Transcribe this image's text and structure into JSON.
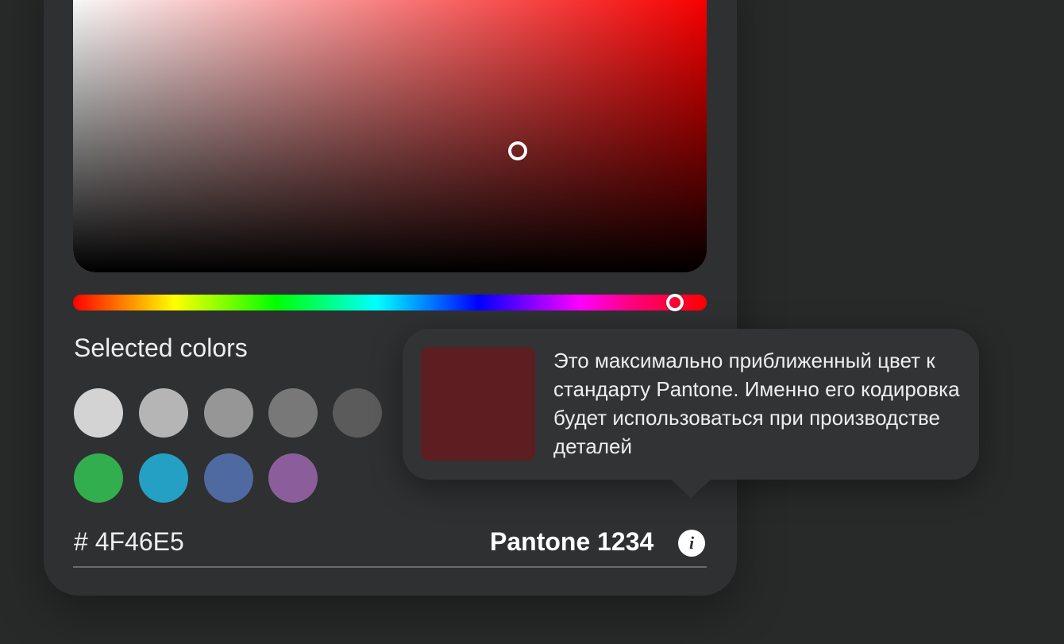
{
  "colors": {
    "background": "#282929",
    "panel": "#2f3032",
    "hue_base": "#ff0000",
    "pantone_swatch": "#5c1e21"
  },
  "picker": {
    "hue_slider_value_percent": 95,
    "saturation_percent": 70,
    "brightness_percent": 54
  },
  "selected": {
    "title": "Selected colors",
    "swatches": [
      {
        "name": "light-gray",
        "color": "#d3d3d3"
      },
      {
        "name": "gray-1",
        "color": "#b5b5b5"
      },
      {
        "name": "gray-2",
        "color": "#969696"
      },
      {
        "name": "gray-3",
        "color": "#787878"
      },
      {
        "name": "gray-4",
        "color": "#5c5b5b"
      },
      {
        "name": "green",
        "color": "#33ae4e"
      },
      {
        "name": "cyan",
        "color": "#24a0c4"
      },
      {
        "name": "blue",
        "color": "#4e6aa0"
      },
      {
        "name": "purple",
        "color": "#8b5e9b"
      }
    ]
  },
  "hex": {
    "value": "# 4F46E5"
  },
  "pantone": {
    "label": "Pantone 1234",
    "info_icon": "info-icon"
  },
  "tooltip": {
    "text": "Это максимально приближенный цвет к стандарту Pantone. Именно его кодировка будет использоваться при производстве деталей"
  }
}
